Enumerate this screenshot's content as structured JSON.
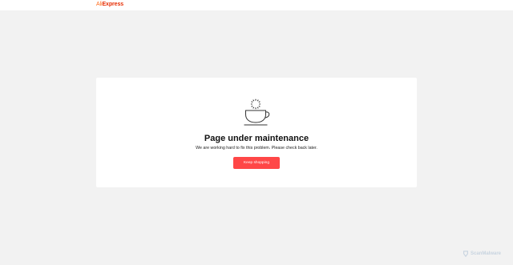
{
  "header": {
    "logo_ali": "Ali",
    "logo_express": "Express"
  },
  "maintenance": {
    "title": "Page under maintenance",
    "message": "We are working hard to fix this problem. Please check back later.",
    "button_label": "Keep shopping"
  },
  "watermark": {
    "text": "ScanMalware"
  },
  "colors": {
    "brand_orange": "#ff6a1a",
    "brand_red": "#e62e04",
    "button_red": "#ff4747",
    "page_bg": "#f2f2f2"
  },
  "icons": {
    "illustration": "coffee-cup-icon",
    "watermark": "scanmalware-logo-icon"
  }
}
